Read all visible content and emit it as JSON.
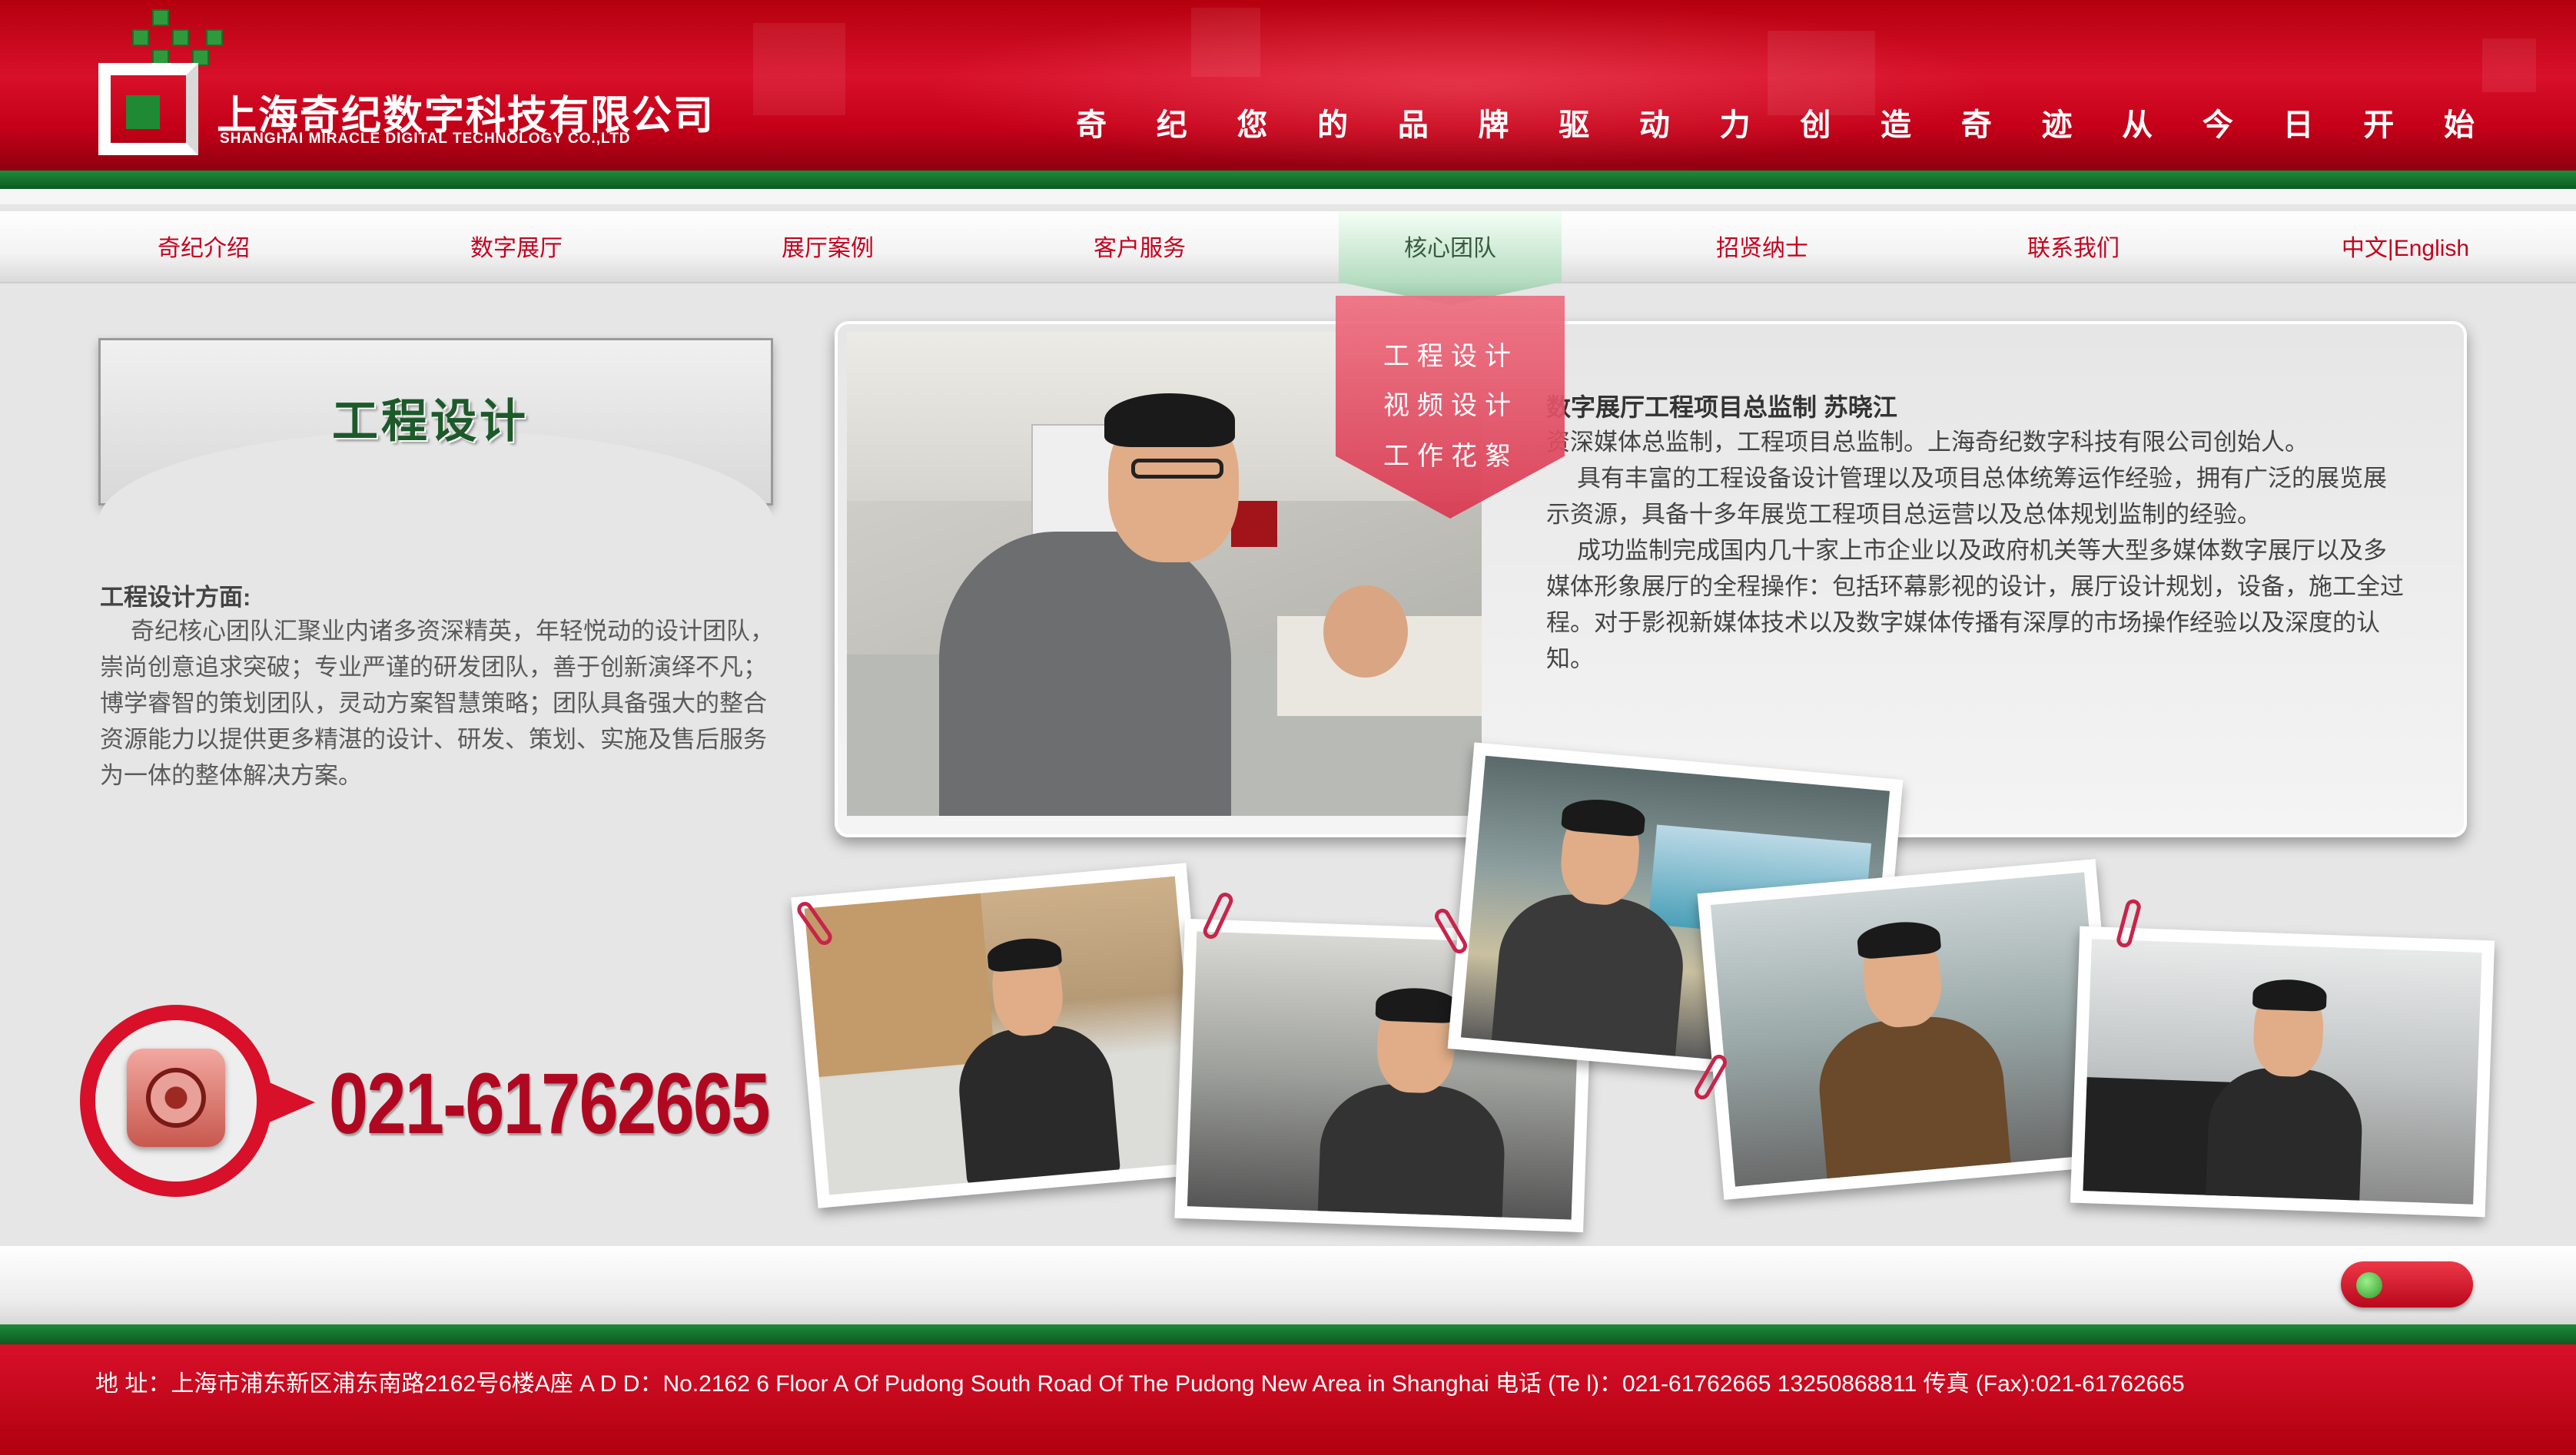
{
  "header": {
    "company_cn": "上海奇纪数字科技有限公司",
    "company_en": "SHANGHAI MIRACLE DIGITAL TECHNOLOGY CO.,LTD",
    "slogan_chars": [
      "奇",
      "纪",
      "您",
      "的",
      "品",
      "牌",
      "驱",
      "动",
      "力",
      "创",
      "造",
      "奇",
      "迹",
      "从",
      "今",
      "日",
      "开",
      "始"
    ]
  },
  "nav": {
    "items": [
      "奇纪介绍",
      "数字展厅",
      "展厅案例",
      "客户服务",
      "核心团队",
      "招贤纳士",
      "联系我们",
      "中文|English"
    ],
    "active": "核心团队",
    "dropdown": [
      "工程设计",
      "视频设计",
      "工作花絮"
    ]
  },
  "left": {
    "section_title": "工程设计",
    "desc_head": "工程设计方面:",
    "desc_body": "奇纪核心团队汇聚业内诸多资深精英，年轻悦动的设计团队，崇尚创意追求突破；专业严谨的研发团队，善于创新演绎不凡；博学睿智的策划团队，灵动方案智慧策略；团队具备强大的整合资源能力以提供更多精湛的设计、研发、策划、实施及售后服务为一体的整体解决方案。",
    "phone": "021-61762665"
  },
  "profile": {
    "title": "数字展厅工程项目总监制  苏晓江",
    "line1": "资深媒体总监制，工程项目总监制。上海奇纪数字科技有限公司创始人。",
    "para2": "具有丰富的工程设备设计管理以及项目总体统筹运作经验，拥有广泛的展览展示资源，具备十多年展览工程项目总运营以及总体规划监制的经验。",
    "para3": "成功监制完成国内几十家上市企业以及政府机关等大型多媒体数字展厅以及多媒体形象展厅的全程操作：包括环幕影视的设计，展厅设计规划，设备，施工全过程。对于影视新媒体技术以及数字媒体传播有深厚的市场操作经验以及深度的认知。"
  },
  "footer": {
    "address": "地      址：上海市浦东新区浦东南路2162号6楼A座   A    D    D：No.2162 6 Floor A Of Pudong South Road Of The Pudong New Area in Shanghai  电话 (Te l)：021-61762665 13250868811  传真 (Fax):021-61762665"
  },
  "colors": {
    "brand_red": "#d8102a",
    "brand_green": "#1e8a3a"
  }
}
